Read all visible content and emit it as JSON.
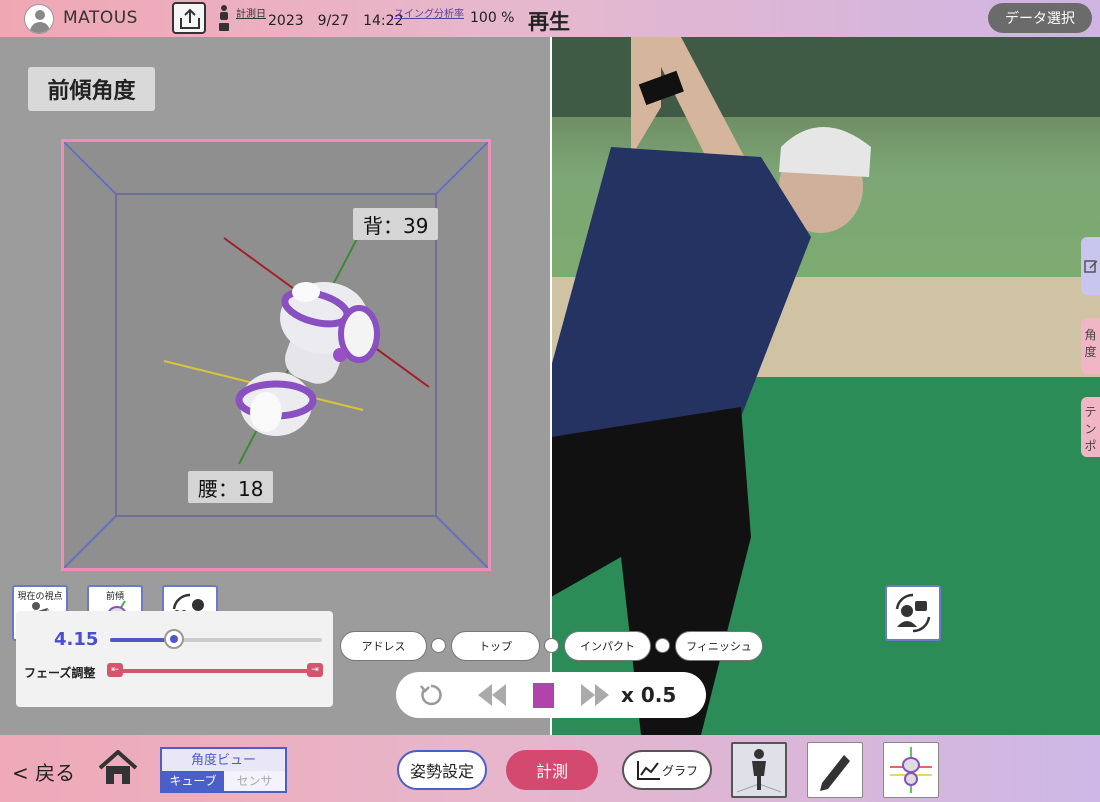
{
  "header": {
    "username": "MATOUS",
    "measure_label": "計測日",
    "date": "2023　9/27　14:22",
    "swing_label": "スイング分析率",
    "swing_pct": "100 %",
    "mode": "再生",
    "data_select": "データ選択"
  },
  "left": {
    "title": "前傾角度",
    "back_label": "背：39",
    "waist_label": "腰：18",
    "view_current": "現在の視点",
    "view_forward": "前傾",
    "slider_value": "4.15",
    "slider_position": 0.3,
    "phase_adjust": "フェーズ調整"
  },
  "phases": [
    "アドレス",
    "トップ",
    "インパクト",
    "フィニッシュ"
  ],
  "playback": {
    "speed": "x 0.5"
  },
  "side_tabs": [
    "角度",
    "テンポ"
  ],
  "footer": {
    "back": "< 戻る",
    "angle_view_title": "角度ビュー",
    "tab_cube": "キューブ",
    "tab_sensor": "センサ",
    "posture": "姿勢設定",
    "measure": "計測",
    "graph": "グラフ"
  }
}
